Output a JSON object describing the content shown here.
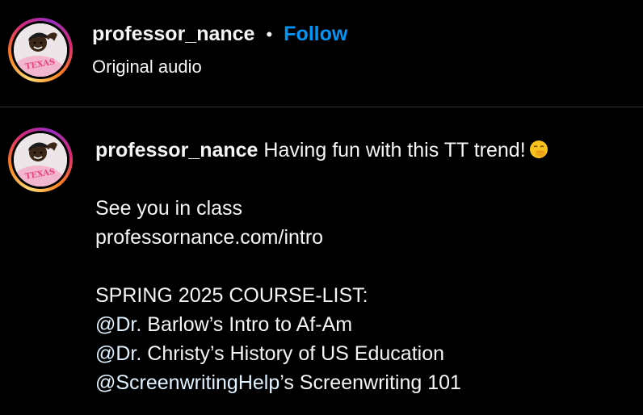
{
  "header": {
    "username": "professor_nance",
    "separator": "•",
    "follow_label": "Follow",
    "subtitle": "Original audio"
  },
  "avatar": {
    "shirt_text": "TEXAS"
  },
  "caption": {
    "username": "professor_nance",
    "text": "Having fun with this TT trend!",
    "emoji_icon": "face-with-hand-over-mouth-emoji",
    "line2": "See you in class",
    "line3": "professornance.com/intro",
    "line5": "SPRING 2025 COURSE-LIST:",
    "courses": [
      {
        "mention": "@Dr.",
        "rest": " Barlow’s Intro to Af-Am"
      },
      {
        "mention": "@Dr.",
        "rest": " Christy’s History of US Education"
      },
      {
        "mention": "@ScreenwritingHelp",
        "rest": "’s Screenwriting 101"
      }
    ]
  },
  "colors": {
    "background": "#000000",
    "text": "#f5f5f5",
    "follow": "#0095f6",
    "mention": "#e0f1ff",
    "divider": "#363636"
  }
}
